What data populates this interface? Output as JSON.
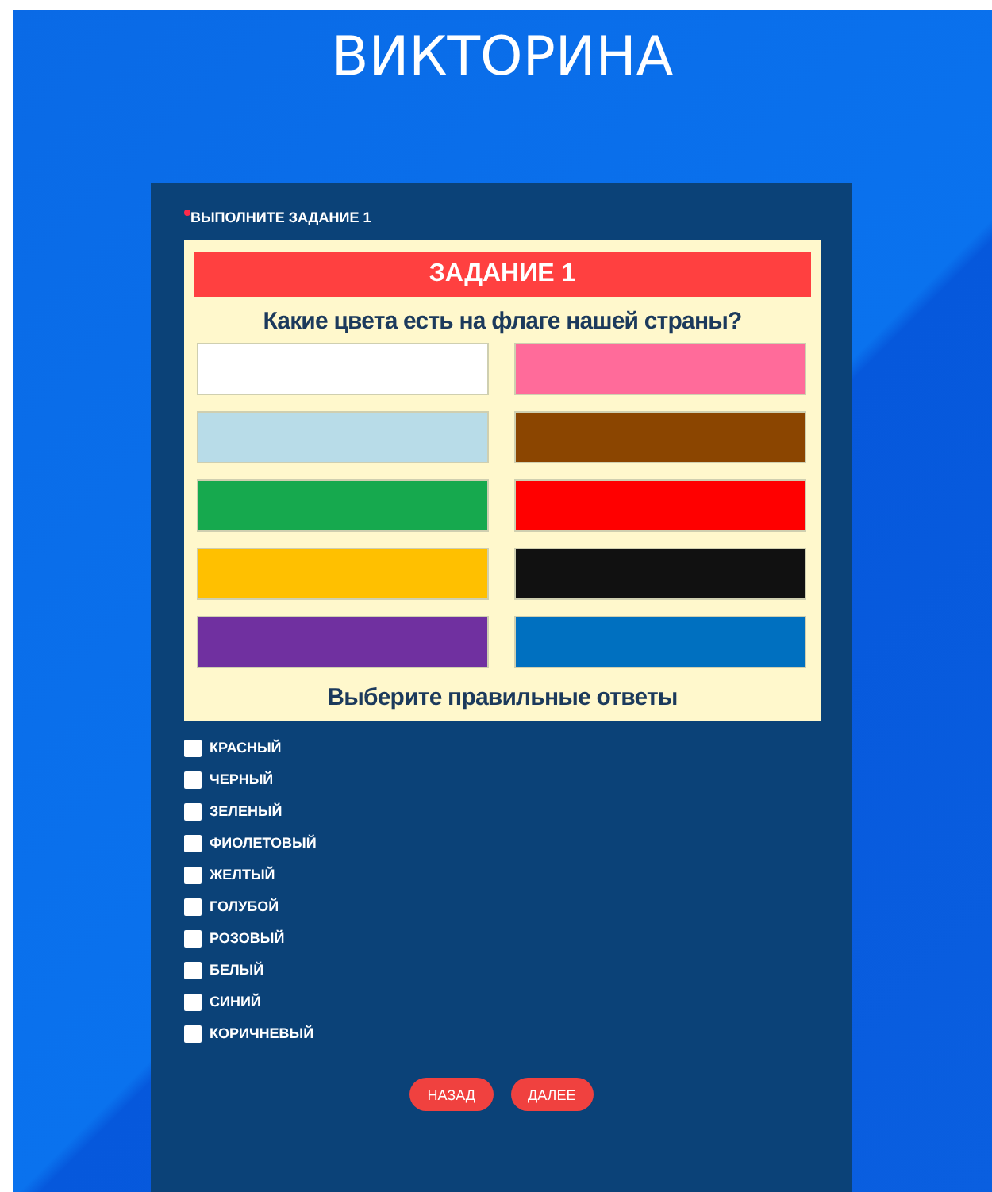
{
  "title": "ВИКТОРИНА",
  "question": {
    "required": true,
    "label": "ВЫПОЛНИТЕ ЗАДАНИЕ 1",
    "task_image": {
      "heading": "ЗАДАНИЕ 1",
      "question": "Какие цвета есть на флаге нашей страны?",
      "swatches": [
        {
          "color": "#ffffff"
        },
        {
          "color": "#ff6b9a"
        },
        {
          "color": "#b8dce8"
        },
        {
          "color": "#8b4500"
        },
        {
          "color": "#16a94e"
        },
        {
          "color": "#ff0000"
        },
        {
          "color": "#ffc000"
        },
        {
          "color": "#111111"
        },
        {
          "color": "#7030a0"
        },
        {
          "color": "#0070c0"
        }
      ],
      "footer": "Выберите правильные ответы"
    },
    "options": [
      {
        "label": "КРАСНЫЙ",
        "checked": false
      },
      {
        "label": "ЧЕРНЫЙ",
        "checked": false
      },
      {
        "label": "ЗЕЛЕНЫЙ",
        "checked": false
      },
      {
        "label": "ФИОЛЕТОВЫЙ",
        "checked": false
      },
      {
        "label": "ЖЕЛТЫЙ",
        "checked": false
      },
      {
        "label": "ГОЛУБОЙ",
        "checked": false
      },
      {
        "label": "РОЗОВЫЙ",
        "checked": false
      },
      {
        "label": "БЕЛЫЙ",
        "checked": false
      },
      {
        "label": "СИНИЙ",
        "checked": false
      },
      {
        "label": "КОРИЧНЕВЫЙ",
        "checked": false
      }
    ]
  },
  "buttons": [
    "НАЗАД",
    "ДАЛЕЕ"
  ]
}
